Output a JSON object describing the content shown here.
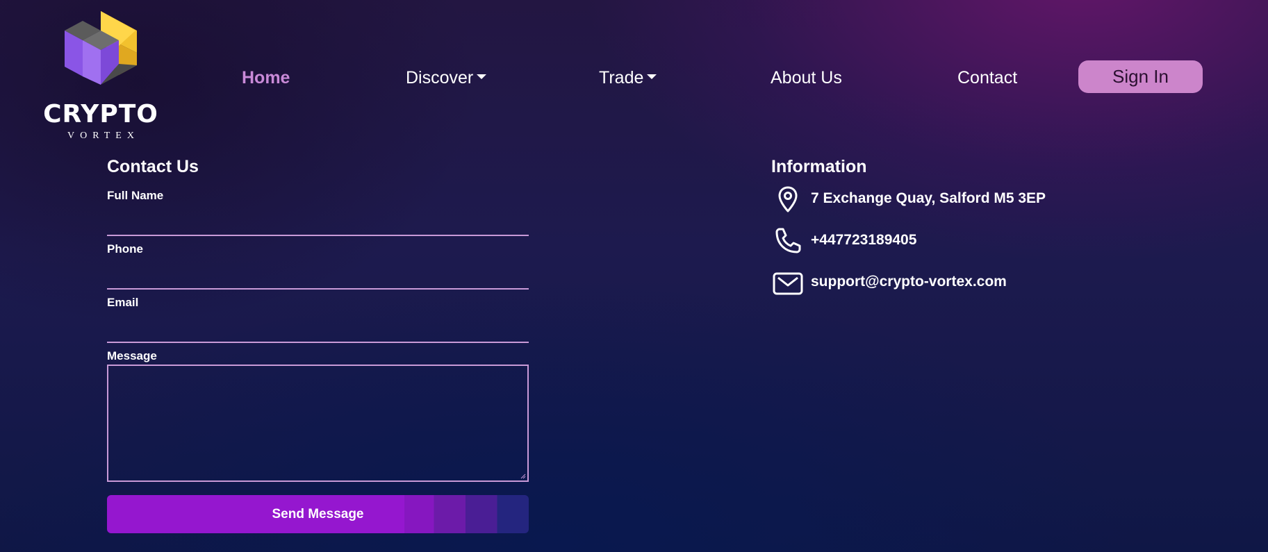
{
  "brand": {
    "name": "CRYPTO",
    "tagline": "VORTEX",
    "logo_icon": "crypto-vortex-logo-icon"
  },
  "nav": {
    "items": [
      {
        "label": "Home",
        "active": true
      },
      {
        "label": "Discover",
        "dropdown": true
      },
      {
        "label": "Trade",
        "dropdown": true
      },
      {
        "label": "About Us"
      },
      {
        "label": "Contact"
      }
    ],
    "signin_label": "Sign In"
  },
  "contact_form": {
    "title": "Contact Us",
    "full_name_label": "Full Name",
    "full_name_value": "",
    "phone_label": "Phone",
    "phone_value": "",
    "email_label": "Email",
    "email_value": "",
    "message_label": "Message",
    "message_value": "",
    "submit_label": "Send Message"
  },
  "information": {
    "title": "Information",
    "address": "7 Exchange Quay, Salford M5 3EP",
    "phone": "+447723189405",
    "email": "support@crypto-vortex.com",
    "icons": [
      "map-pin-icon",
      "phone-icon",
      "envelope-icon"
    ]
  },
  "colors": {
    "accent": "#c98ad8",
    "signin_bg": "#cc85cb",
    "button_purple": "#9517cf",
    "input_border": "#c99ad8"
  }
}
